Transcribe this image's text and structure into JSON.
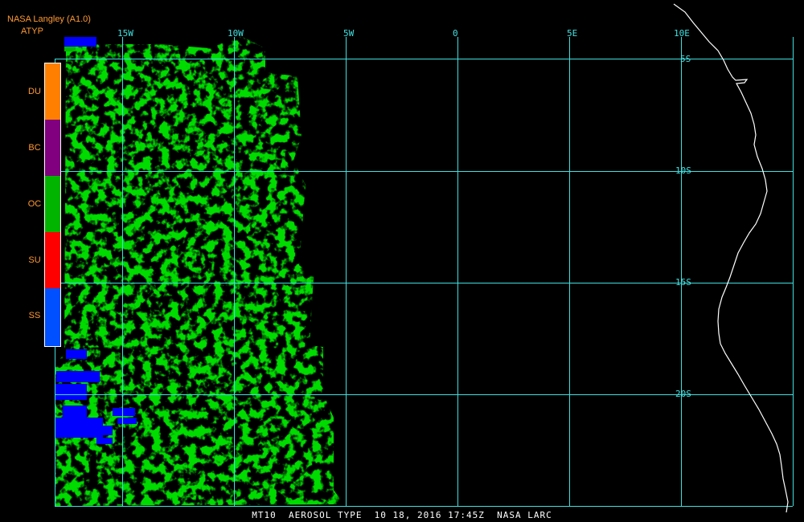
{
  "header": {
    "source": "NASA Langley (A1.0)",
    "product": "ATYP"
  },
  "legend": {
    "items": [
      {
        "label": "DU",
        "color": "#ff8000"
      },
      {
        "label": "BC",
        "color": "#800080"
      },
      {
        "label": "OC",
        "color": "#00b400"
      },
      {
        "label": "SU",
        "color": "#ff0000"
      },
      {
        "label": "SS",
        "color": "#0050ff"
      }
    ]
  },
  "map": {
    "longitude_labels": [
      "15W",
      "10W",
      "5W",
      "0",
      "5E",
      "10E"
    ],
    "latitude_labels": [
      "5S",
      "10S",
      "15S",
      "20S"
    ],
    "grid_color": "#40e0e0",
    "coastline_color": "#ffffff"
  },
  "footer": {
    "caption": "MT10  AEROSOL TYPE  10 18, 2016 17:45Z  NASA LARC"
  }
}
